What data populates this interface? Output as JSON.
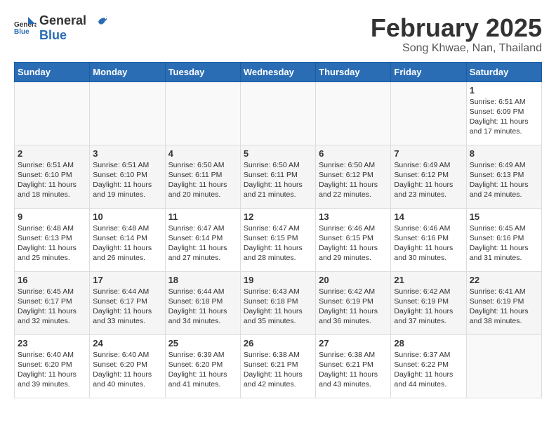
{
  "header": {
    "logo_general": "General",
    "logo_blue": "Blue",
    "month_title": "February 2025",
    "location": "Song Khwae, Nan, Thailand"
  },
  "days_of_week": [
    "Sunday",
    "Monday",
    "Tuesday",
    "Wednesday",
    "Thursday",
    "Friday",
    "Saturday"
  ],
  "weeks": [
    [
      {
        "day": "",
        "info": ""
      },
      {
        "day": "",
        "info": ""
      },
      {
        "day": "",
        "info": ""
      },
      {
        "day": "",
        "info": ""
      },
      {
        "day": "",
        "info": ""
      },
      {
        "day": "",
        "info": ""
      },
      {
        "day": "1",
        "info": "Sunrise: 6:51 AM\nSunset: 6:09 PM\nDaylight: 11 hours and 17 minutes."
      }
    ],
    [
      {
        "day": "2",
        "info": "Sunrise: 6:51 AM\nSunset: 6:10 PM\nDaylight: 11 hours and 18 minutes."
      },
      {
        "day": "3",
        "info": "Sunrise: 6:51 AM\nSunset: 6:10 PM\nDaylight: 11 hours and 19 minutes."
      },
      {
        "day": "4",
        "info": "Sunrise: 6:50 AM\nSunset: 6:11 PM\nDaylight: 11 hours and 20 minutes."
      },
      {
        "day": "5",
        "info": "Sunrise: 6:50 AM\nSunset: 6:11 PM\nDaylight: 11 hours and 21 minutes."
      },
      {
        "day": "6",
        "info": "Sunrise: 6:50 AM\nSunset: 6:12 PM\nDaylight: 11 hours and 22 minutes."
      },
      {
        "day": "7",
        "info": "Sunrise: 6:49 AM\nSunset: 6:12 PM\nDaylight: 11 hours and 23 minutes."
      },
      {
        "day": "8",
        "info": "Sunrise: 6:49 AM\nSunset: 6:13 PM\nDaylight: 11 hours and 24 minutes."
      }
    ],
    [
      {
        "day": "9",
        "info": "Sunrise: 6:48 AM\nSunset: 6:13 PM\nDaylight: 11 hours and 25 minutes."
      },
      {
        "day": "10",
        "info": "Sunrise: 6:48 AM\nSunset: 6:14 PM\nDaylight: 11 hours and 26 minutes."
      },
      {
        "day": "11",
        "info": "Sunrise: 6:47 AM\nSunset: 6:14 PM\nDaylight: 11 hours and 27 minutes."
      },
      {
        "day": "12",
        "info": "Sunrise: 6:47 AM\nSunset: 6:15 PM\nDaylight: 11 hours and 28 minutes."
      },
      {
        "day": "13",
        "info": "Sunrise: 6:46 AM\nSunset: 6:15 PM\nDaylight: 11 hours and 29 minutes."
      },
      {
        "day": "14",
        "info": "Sunrise: 6:46 AM\nSunset: 6:16 PM\nDaylight: 11 hours and 30 minutes."
      },
      {
        "day": "15",
        "info": "Sunrise: 6:45 AM\nSunset: 6:16 PM\nDaylight: 11 hours and 31 minutes."
      }
    ],
    [
      {
        "day": "16",
        "info": "Sunrise: 6:45 AM\nSunset: 6:17 PM\nDaylight: 11 hours and 32 minutes."
      },
      {
        "day": "17",
        "info": "Sunrise: 6:44 AM\nSunset: 6:17 PM\nDaylight: 11 hours and 33 minutes."
      },
      {
        "day": "18",
        "info": "Sunrise: 6:44 AM\nSunset: 6:18 PM\nDaylight: 11 hours and 34 minutes."
      },
      {
        "day": "19",
        "info": "Sunrise: 6:43 AM\nSunset: 6:18 PM\nDaylight: 11 hours and 35 minutes."
      },
      {
        "day": "20",
        "info": "Sunrise: 6:42 AM\nSunset: 6:19 PM\nDaylight: 11 hours and 36 minutes."
      },
      {
        "day": "21",
        "info": "Sunrise: 6:42 AM\nSunset: 6:19 PM\nDaylight: 11 hours and 37 minutes."
      },
      {
        "day": "22",
        "info": "Sunrise: 6:41 AM\nSunset: 6:19 PM\nDaylight: 11 hours and 38 minutes."
      }
    ],
    [
      {
        "day": "23",
        "info": "Sunrise: 6:40 AM\nSunset: 6:20 PM\nDaylight: 11 hours and 39 minutes."
      },
      {
        "day": "24",
        "info": "Sunrise: 6:40 AM\nSunset: 6:20 PM\nDaylight: 11 hours and 40 minutes."
      },
      {
        "day": "25",
        "info": "Sunrise: 6:39 AM\nSunset: 6:20 PM\nDaylight: 11 hours and 41 minutes."
      },
      {
        "day": "26",
        "info": "Sunrise: 6:38 AM\nSunset: 6:21 PM\nDaylight: 11 hours and 42 minutes."
      },
      {
        "day": "27",
        "info": "Sunrise: 6:38 AM\nSunset: 6:21 PM\nDaylight: 11 hours and 43 minutes."
      },
      {
        "day": "28",
        "info": "Sunrise: 6:37 AM\nSunset: 6:22 PM\nDaylight: 11 hours and 44 minutes."
      },
      {
        "day": "",
        "info": ""
      }
    ]
  ]
}
